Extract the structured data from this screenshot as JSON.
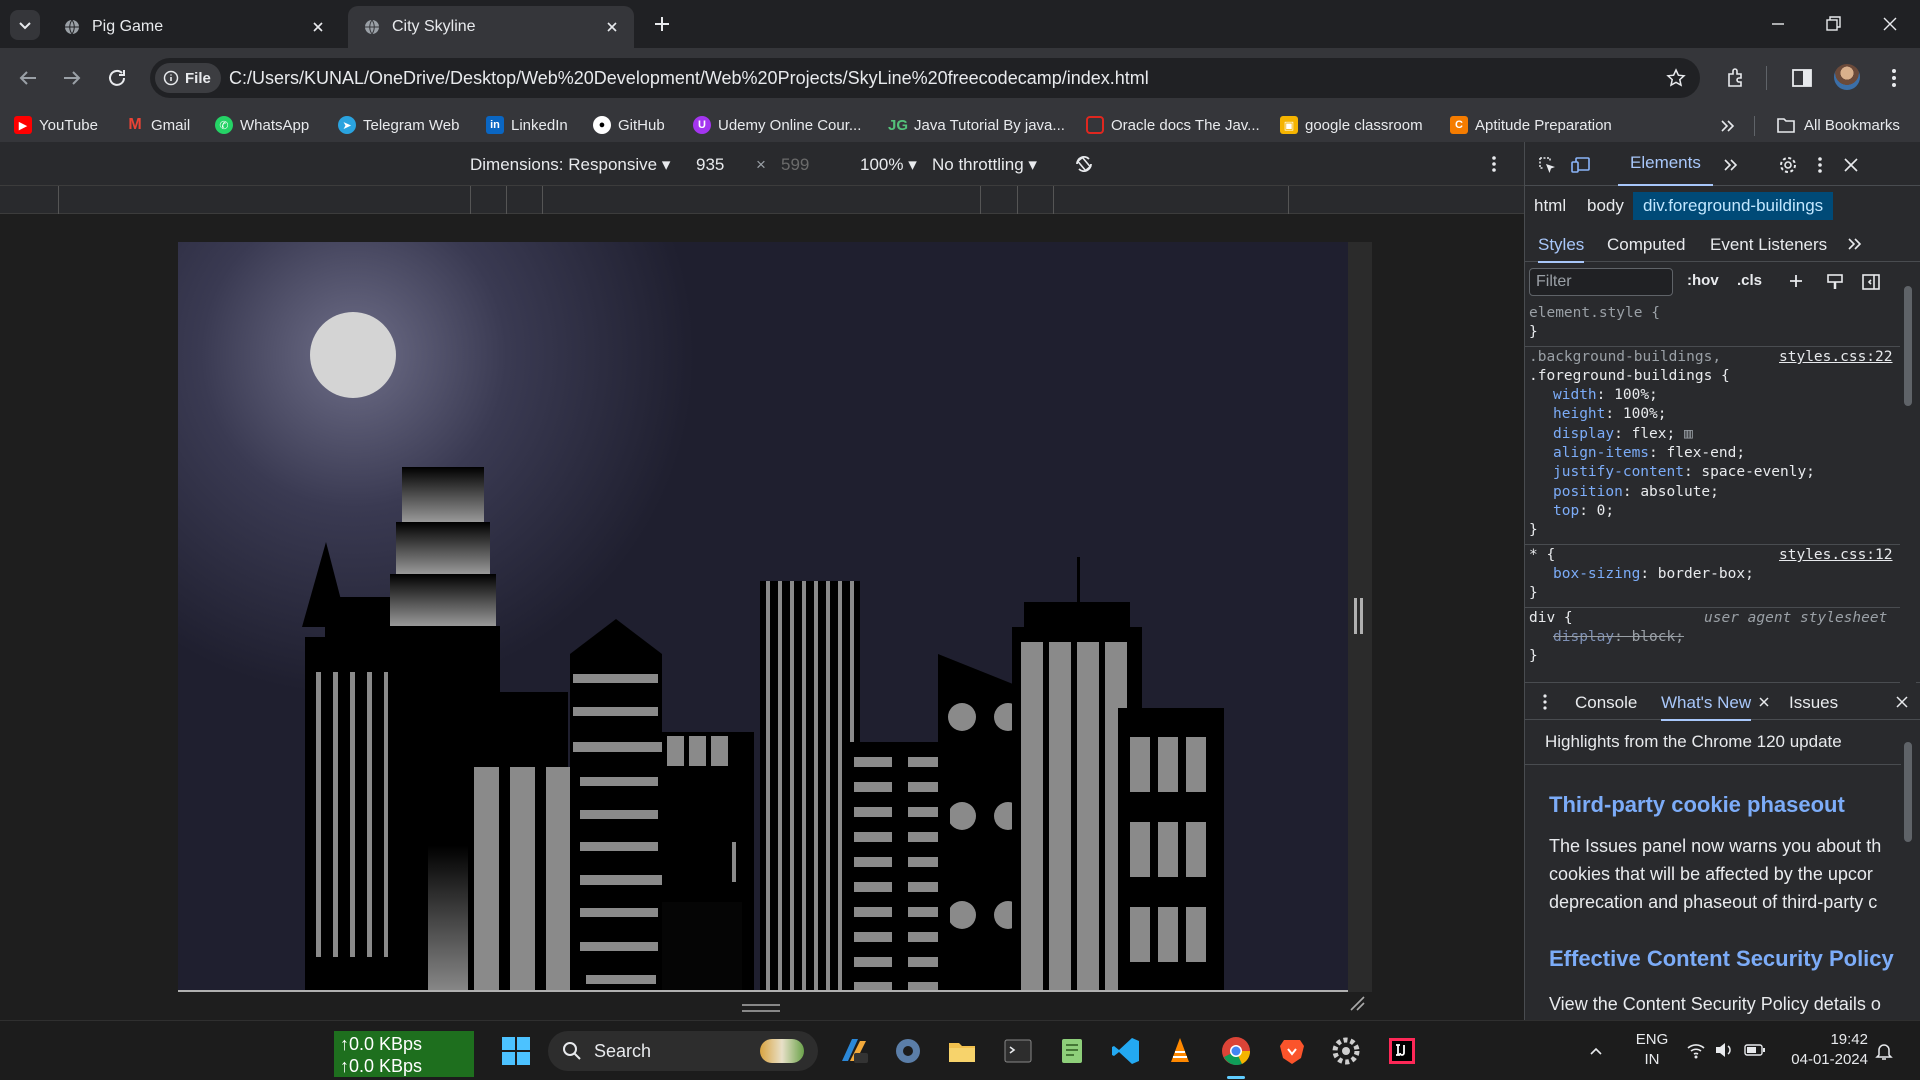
{
  "browser": {
    "tabs": [
      {
        "title": "Pig Game"
      },
      {
        "title": "City Skyline"
      }
    ],
    "url_chip": "File",
    "url": "C:/Users/KUNAL/OneDrive/Desktop/Web%20Development/Web%20Projects/SkyLine%20freecodecamp/index.html",
    "bookmarks": [
      {
        "label": "YouTube",
        "icon": "youtube-icon",
        "color": "#ff0000"
      },
      {
        "label": "Gmail",
        "icon": "gmail-icon",
        "color": "#ea4335"
      },
      {
        "label": "WhatsApp",
        "icon": "whatsapp-icon",
        "color": "#25d366"
      },
      {
        "label": "Telegram Web",
        "icon": "telegram-icon",
        "color": "#2aa3df"
      },
      {
        "label": "LinkedIn",
        "icon": "linkedin-icon",
        "color": "#0a66c2"
      },
      {
        "label": "GitHub",
        "icon": "github-icon",
        "color": "#ffffff"
      },
      {
        "label": "Udemy Online Cour...",
        "icon": "udemy-icon",
        "color": "#a435f0"
      },
      {
        "label": "Java Tutorial By java...",
        "icon": "java-icon",
        "color": "#54c27a"
      },
      {
        "label": "Oracle docs The Jav...",
        "icon": "oracle-icon",
        "color": "#e0271f"
      },
      {
        "label": "google classroom",
        "icon": "classroom-icon",
        "color": "#f5b400"
      },
      {
        "label": "Aptitude Preparation",
        "icon": "aptitude-icon",
        "color": "#f57c00"
      }
    ],
    "all_bookmarks": "All Bookmarks"
  },
  "device_toolbar": {
    "dimensions": "Dimensions: Responsive",
    "width": "935",
    "x": "×",
    "height": "599",
    "zoom": "100%",
    "throttling": "No throttling"
  },
  "devtools": {
    "panel_tab": "Elements",
    "breadcrumbs": [
      "html",
      "body",
      "div.foreground-buildings"
    ],
    "style_tabs": [
      "Styles",
      "Computed",
      "Event Listeners"
    ],
    "filter_placeholder": "Filter",
    "hov": ":hov",
    "cls": ".cls",
    "rules": {
      "element_style": "element.style {",
      "brace_close": "}",
      "rule1_selector_a": ".background-buildings,",
      "rule1_selector_b": ".foreground-buildings {",
      "rule1_source": "styles.css:22",
      "rule1_props": [
        {
          "name": "width",
          "value": "100%;"
        },
        {
          "name": "height",
          "value": "100%;"
        },
        {
          "name": "display",
          "value": "flex;"
        },
        {
          "name": "align-items",
          "value": "flex-end;"
        },
        {
          "name": "justify-content",
          "value": "space-evenly;"
        },
        {
          "name": "position",
          "value": "absolute;"
        },
        {
          "name": "top",
          "value": "0;"
        }
      ],
      "rule2_selector": "* {",
      "rule2_source": "styles.css:12",
      "rule2_prop": {
        "name": "box-sizing",
        "value": "border-box;"
      },
      "rule3_selector": "div {",
      "rule3_source": "user agent stylesheet",
      "rule3_prop": {
        "name": "display",
        "value": "block;"
      }
    },
    "drawer_tabs": [
      "Console",
      "What's New",
      "Issues"
    ],
    "whats_new": {
      "highlight": "Highlights from the Chrome 120 update",
      "h1": "Third-party cookie phaseout",
      "p1": [
        "The Issues panel now warns you about th",
        "cookies that will be affected by the upcor",
        "deprecation and phaseout of third-party c"
      ],
      "h2": "Effective Content Security Policy",
      "p2": "View the Content Security Policy details o"
    }
  },
  "taskbar": {
    "net_up": "↑0.0 KBps",
    "net_down": "↑0.0 KBps",
    "search": "Search",
    "lang1": "ENG",
    "lang2": "IN",
    "time": "19:42",
    "date": "04-01-2024"
  }
}
